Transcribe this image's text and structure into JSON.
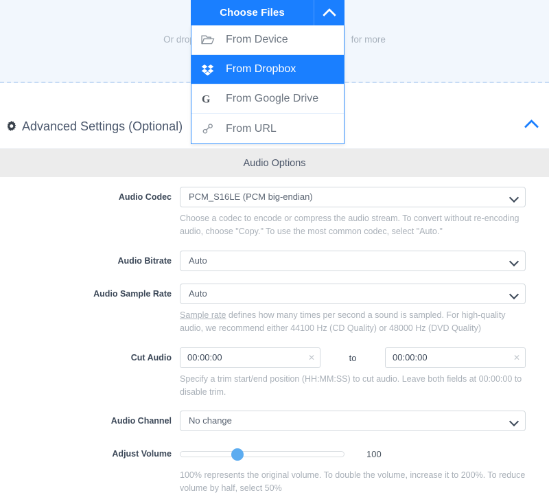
{
  "dropzone": {
    "text_before": "Or drop ",
    "text_after": "for more",
    "hidden_note": "dropzone text is partially occluded by the open Choose Files menu"
  },
  "chooser": {
    "button_label": "Choose Files",
    "caret_icon": "chevron-up-icon",
    "items": [
      {
        "label": "From Device",
        "icon": "folder-open-icon",
        "active": false
      },
      {
        "label": "From Dropbox",
        "icon": "dropbox-icon",
        "active": true
      },
      {
        "label": "From Google Drive",
        "icon": "google-g-icon",
        "active": false
      },
      {
        "label": "From URL",
        "icon": "link-icon",
        "active": false
      }
    ]
  },
  "advanced": {
    "title": "Advanced Settings (Optional)",
    "gear_icon": "gear-icon",
    "collapse_icon": "chevron-up-icon"
  },
  "section": {
    "title": "Audio Options"
  },
  "fields": {
    "audio_codec": {
      "label": "Audio Codec",
      "value": "PCM_S16LE (PCM big-endian)",
      "helper": "Choose a codec to encode or compress the audio stream. To convert without re-encoding audio, choose \"Copy.\" To use the most common codec, select \"Auto.\""
    },
    "audio_bitrate": {
      "label": "Audio Bitrate",
      "value": "Auto"
    },
    "audio_sample_rate": {
      "label": "Audio Sample Rate",
      "value": "Auto",
      "helper_link": "Sample rate",
      "helper": " defines how many times per second a sound is sampled. For high-quality audio, we recommend either 44100 Hz (CD Quality) or 48000 Hz (DVD Quality)"
    },
    "cut_audio": {
      "label": "Cut Audio",
      "start_value": "00:00:00",
      "separator": "to",
      "end_value": "00:00:00",
      "clear_icon": "close-x-icon",
      "helper": "Specify a trim start/end position (HH:MM:SS) to cut audio. Leave both fields at 00:00:00 to disable trim."
    },
    "audio_channel": {
      "label": "Audio Channel",
      "value": "No change"
    },
    "adjust_volume": {
      "label": "Adjust Volume",
      "value": "100",
      "slider_percent": 35,
      "helper": "100% represents the original volume. To double the volume, increase it to 200%. To reduce volume by half, select 50%"
    }
  },
  "colors": {
    "accent_blue": "#1a7fff",
    "dropzone_bg": "#f2f7fd",
    "section_bg": "#ececec",
    "slider_thumb": "#5cacf0"
  }
}
